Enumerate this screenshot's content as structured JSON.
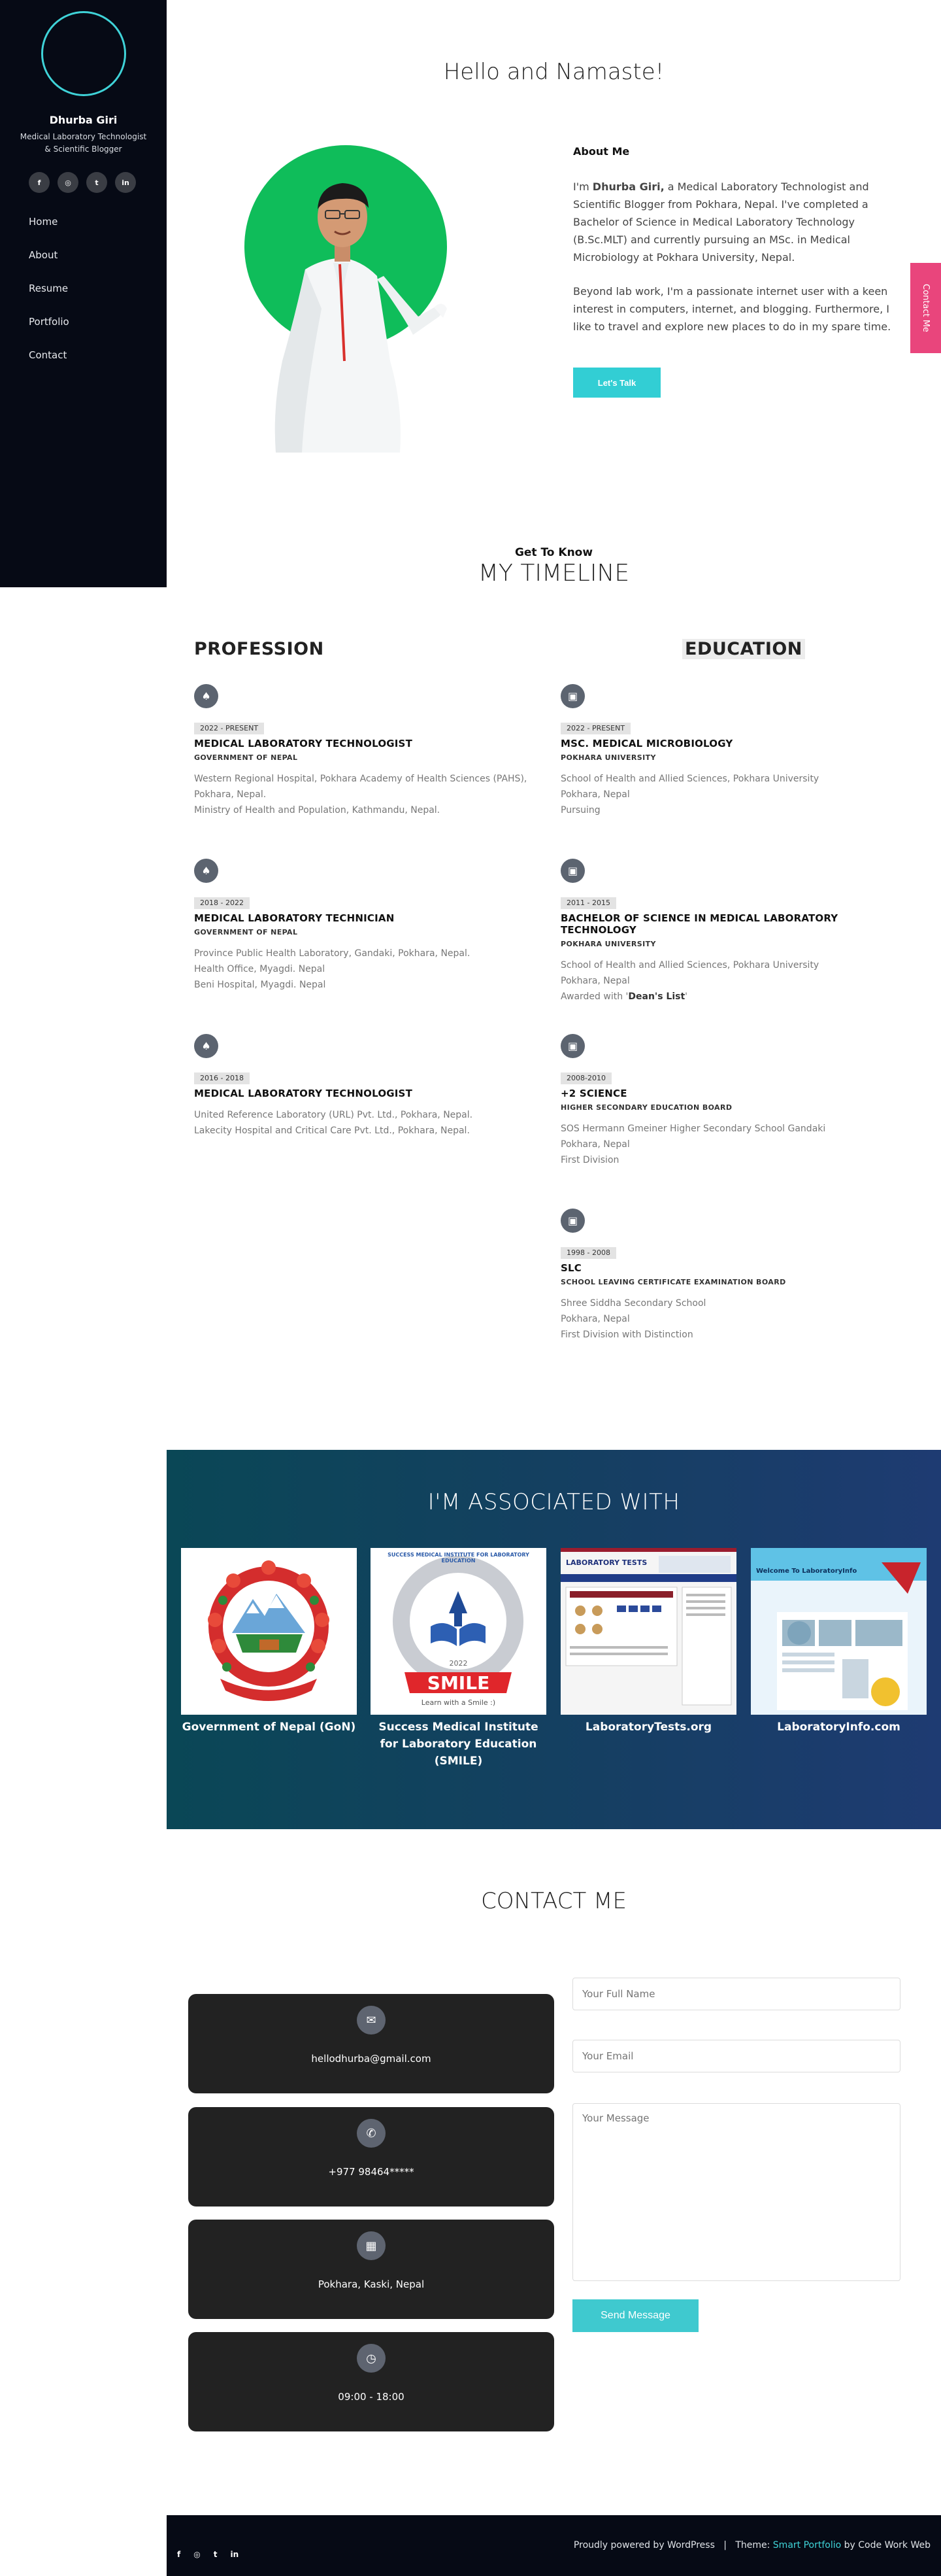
{
  "sidebar": {
    "name": "Dhurba Giri",
    "subtitle": "Medical Laboratory Technologist & Scientific Blogger",
    "social": [
      "f",
      "◎",
      "t",
      "in"
    ],
    "nav": [
      "Home",
      "About",
      "Resume",
      "Portfolio",
      "Contact"
    ]
  },
  "hero": {
    "title": "Hello and Namaste!",
    "about_heading": "About Me",
    "about_p1_prefix": "I'm ",
    "about_p1_name": "Dhurba Giri,",
    "about_p1_rest": " a Medical Laboratory Technologist and Scientific Blogger from Pokhara, Nepal. I've completed a Bachelor of Science in Medical Laboratory Technology (B.Sc.MLT) and currently pursuing an MSc. in Medical Microbiology at Pokhara University, Nepal.",
    "about_p2": "Beyond lab work, I'm a passionate internet user with a keen interest in computers, internet, and blogging. Furthermore, I like to travel and explore new places to do in my spare time.",
    "cta": "Let's Talk",
    "contact_tab": "Contact Me"
  },
  "timeline": {
    "kicker": "Get To Know",
    "title": "MY TIMELINE",
    "profession_heading": "PROFESSION",
    "education_heading": "EDUCATION",
    "profession": [
      {
        "date": "2022 - PRESENT",
        "role": "MEDICAL LABORATORY TECHNOLOGIST",
        "org": "GOVERNMENT OF NEPAL",
        "lines": [
          "Western Regional Hospital, Pokhara Academy of Health Sciences (PAHS), Pokhara, Nepal.",
          "Ministry of Health and Population, Kathmandu, Nepal."
        ]
      },
      {
        "date": "2018 - 2022",
        "role": "MEDICAL LABORATORY TECHNICIAN",
        "org": "GOVERNMENT OF NEPAL",
        "lines": [
          "Province Public Health Laboratory, Gandaki, Pokhara, Nepal.",
          "Health Office, Myagdi. Nepal",
          "Beni Hospital, Myagdi. Nepal"
        ]
      },
      {
        "date": "2016 - 2018",
        "role": "MEDICAL LABORATORY TECHNOLOGIST",
        "org": "",
        "lines": [
          "United Reference Laboratory (URL) Pvt. Ltd., Pokhara, Nepal.",
          "Lakecity Hospital and Critical Care Pvt. Ltd., Pokhara, Nepal."
        ]
      }
    ],
    "education": [
      {
        "date": "2022 - PRESENT",
        "role": "MSC. MEDICAL MICROBIOLOGY",
        "org": "POKHARA UNIVERSITY",
        "lines": [
          "School of Health and Allied Sciences, Pokhara University",
          "Pokhara, Nepal",
          "Pursuing"
        ]
      },
      {
        "date": "2011 - 2015",
        "role": "BACHELOR OF SCIENCE IN MEDICAL LABORATORY TECHNOLOGY",
        "org": "POKHARA UNIVERSITY",
        "lines": [
          "School of Health and Allied Sciences, Pokhara University",
          "Pokhara, Nepal"
        ],
        "award_prefix": "Awarded with '",
        "award": "Dean's List",
        "award_suffix": "'"
      },
      {
        "date": "2008-2010",
        "role": "+2 SCIENCE",
        "org": "HIGHER SECONDARY EDUCATION BOARD",
        "lines": [
          "SOS Hermann Gmeiner Higher Secondary School Gandaki",
          "Pokhara, Nepal",
          "First Division"
        ]
      },
      {
        "date": "1998 - 2008",
        "role": "SLC",
        "org": "SCHOOL LEAVING CERTIFICATE EXAMINATION BOARD",
        "lines": [
          "Shree Siddha Secondary School",
          "Pokhara, Nepal",
          "First Division with Distinction"
        ]
      }
    ]
  },
  "associated": {
    "title": "I'M ASSOCIATED WITH",
    "cards": [
      {
        "label": "Government of Nepal (GoN)"
      },
      {
        "label": "Success Medical Institute for Laboratory Education (SMILE)",
        "logo_top": "SUCCESS MEDICAL INSTITUTE FOR LABORATORY EDUCATION",
        "logo_year": "2022",
        "logo_word": "SMILE",
        "logo_tag": "Learn with a Smile :)"
      },
      {
        "label": "LaboratoryTests.org",
        "logo_word": "LABORATORY TESTS"
      },
      {
        "label": "LaboratoryInfo.com",
        "logo_word": "Welcome To LaboratoryInfo"
      }
    ]
  },
  "contact": {
    "title": "CONTACT ME",
    "items": [
      {
        "icon": "envelope-icon",
        "glyph": "✉",
        "text": "hellodhurba@gmail.com"
      },
      {
        "icon": "phone-icon",
        "glyph": "✆",
        "text": "+977 98464*****"
      },
      {
        "icon": "building-icon",
        "glyph": "▦",
        "text": "Pokhara, Kaski, Nepal"
      },
      {
        "icon": "clock-icon",
        "glyph": "◷",
        "text": "09:00 - 18:00"
      }
    ],
    "placeholders": {
      "name": "Your Full Name",
      "email": "Your Email",
      "message": "Your Message"
    },
    "send": "Send Message"
  },
  "footer": {
    "social": [
      "f",
      "◎",
      "t",
      "in"
    ],
    "powered": "Proudly powered by WordPress",
    "sep": "|",
    "theme_prefix": "Theme: ",
    "theme_name": "Smart Portfolio",
    "theme_by": " by Code Work Web"
  },
  "colors": {
    "accent": "#32ced4",
    "contact_tab": "#e9457c",
    "sidebar": "#060a15"
  }
}
